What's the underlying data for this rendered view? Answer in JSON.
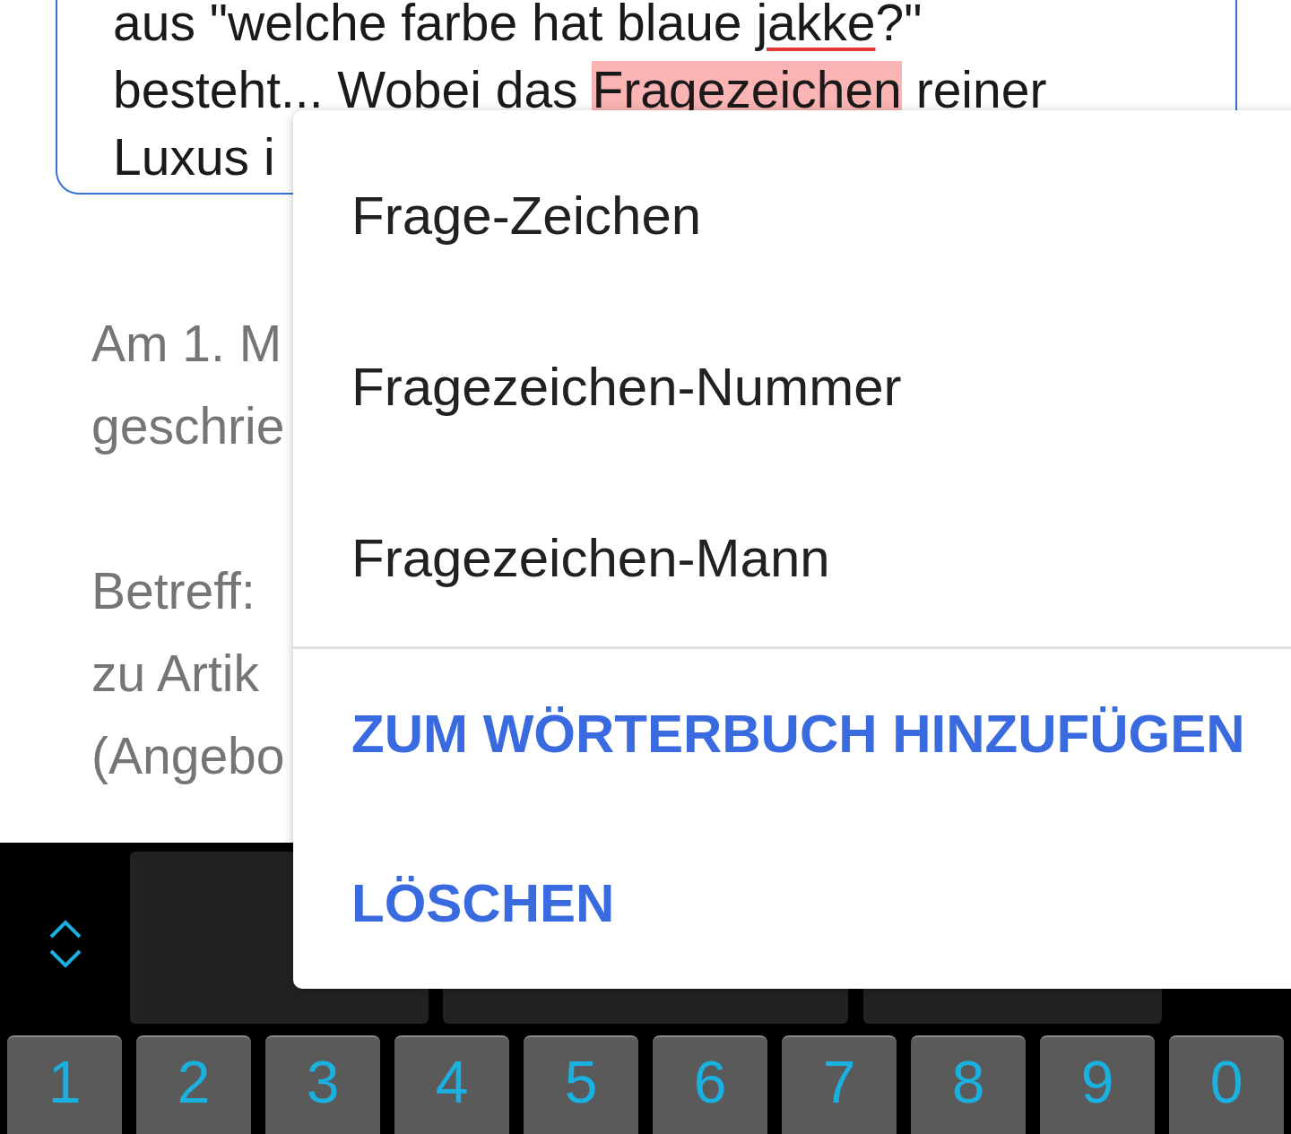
{
  "text_field": {
    "lines": [
      [
        {
          "kind": "plain",
          "text": "aus \"welche farbe hat blaue "
        },
        {
          "kind": "misspelled",
          "text": "jakke"
        },
        {
          "kind": "plain",
          "text": "?\""
        }
      ],
      [
        {
          "kind": "plain",
          "text": "besteht... Wobei das "
        },
        {
          "kind": "selected",
          "text": "Fragezeichen"
        },
        {
          "kind": "plain",
          "text": " reiner"
        }
      ],
      [
        {
          "kind": "plain",
          "text": "Luxus i"
        }
      ]
    ]
  },
  "background_text": {
    "paragraphs": [
      [
        "Am 1. M",
        "geschrie"
      ],
      [
        "Betreff:",
        "zu Artik",
        "(Angebo"
      ]
    ]
  },
  "spelling_menu": {
    "suggestions": [
      "Frage-Zeichen",
      "Fragezeichen-Nummer",
      "Fragezeichen-Mann"
    ],
    "actions": [
      "ZUM WÖRTERBUCH HINZUFÜGEN",
      "LÖSCHEN"
    ]
  },
  "keyboard": {
    "number_keys": [
      "1",
      "2",
      "3",
      "4",
      "5",
      "6",
      "7",
      "8",
      "9",
      "0"
    ]
  }
}
